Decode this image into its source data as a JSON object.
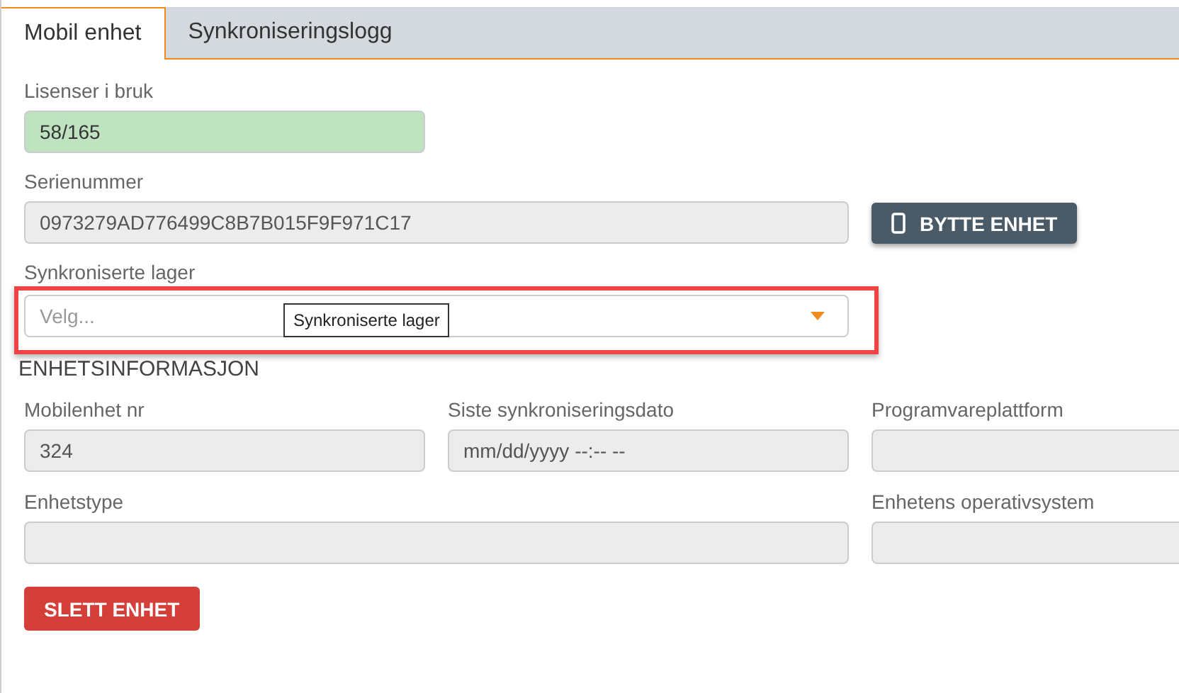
{
  "tabs": [
    {
      "label": "Mobil enhet",
      "selected": true
    },
    {
      "label": "Synkroniseringslogg",
      "selected": false
    }
  ],
  "licenses": {
    "label": "Lisenser i bruk",
    "value": "58/165"
  },
  "serial": {
    "label": "Serienummer",
    "value": "0973279AD776499C8B7B015F9F971C17"
  },
  "swap_button": {
    "label": "BYTTE ENHET"
  },
  "warehouses": {
    "label": "Synkroniserte lager",
    "placeholder": "Velg...",
    "highlighted": true,
    "tooltip": "Synkroniserte lager"
  },
  "device_info": {
    "heading": "ENHETSINFORMASJON",
    "fields": [
      {
        "label": "Mobilenhet nr",
        "value": "324",
        "wide": false
      },
      {
        "label": "Siste synkroniseringsdato",
        "value": "mm/dd/yyyy --:-- --",
        "wide": false
      },
      {
        "label": "Programvareplattform",
        "wide": false
      },
      {
        "label": "Enhetstype",
        "wide": true
      },
      {
        "label": "Enhetens operativsystem",
        "wide": false
      }
    ]
  },
  "delete_button": {
    "label": "SLETT ENHET"
  }
}
